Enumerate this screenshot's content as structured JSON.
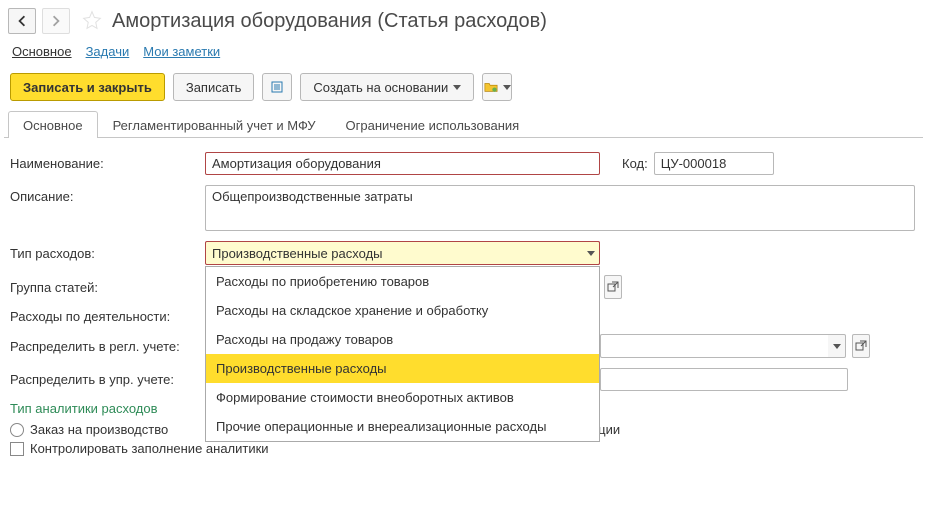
{
  "title": "Амортизация оборудования (Статья расходов)",
  "topnav": {
    "main": "Основное",
    "tasks": "Задачи",
    "notes": "Мои заметки"
  },
  "toolbar": {
    "save_close": "Записать и закрыть",
    "save": "Записать",
    "create_based": "Создать на основании"
  },
  "tabs": {
    "main": "Основное",
    "regl": "Регламентированный учет и МФУ",
    "limit": "Ограничение использования"
  },
  "form": {
    "name_label": "Наименование:",
    "name_value": "Амортизация оборудования",
    "code_label": "Код:",
    "code_value": "ЦУ-000018",
    "desc_label": "Описание:",
    "desc_value": "Общепроизводственные затраты",
    "type_label": "Тип расходов:",
    "type_value": "Производственные расходы",
    "group_label": "Группа статей:",
    "group_value": "",
    "activity_label": "Расходы по деятельности:",
    "dist_regl_label": "Распределить в регл. учете:",
    "dist_upr_label": "Распределить в упр. учете:",
    "analytics_title": "Тип аналитики расходов",
    "radio_order": "Заказ на производство",
    "operation_suffix": "луатации",
    "check_control": "Контролировать заполнение аналитики"
  },
  "dropdown": {
    "options": [
      "Расходы по приобретению товаров",
      "Расходы на складское хранение и обработку",
      "Расходы на продажу товаров",
      "Производственные расходы",
      "Формирование стоимости внеоборотных активов",
      "Прочие операционные и внереализационные расходы"
    ],
    "selected_index": 3
  }
}
